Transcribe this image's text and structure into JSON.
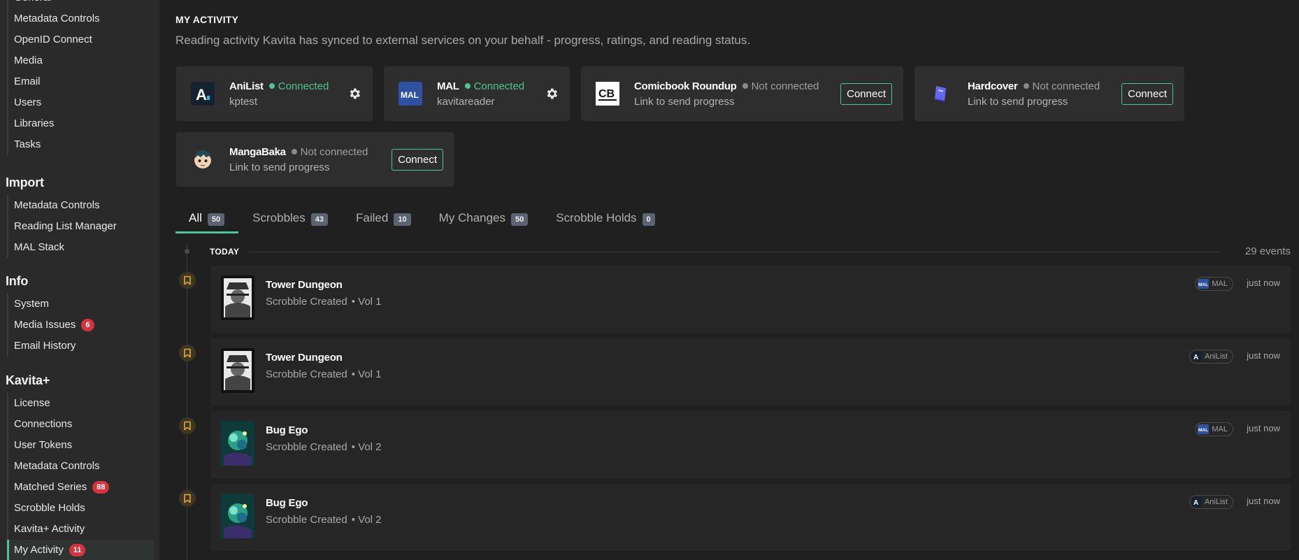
{
  "sidebar": {
    "top_partial_label": "General",
    "top_items": [
      {
        "label": "Metadata Controls"
      },
      {
        "label": "OpenID Connect"
      },
      {
        "label": "Media"
      },
      {
        "label": "Email"
      },
      {
        "label": "Users"
      },
      {
        "label": "Libraries"
      },
      {
        "label": "Tasks"
      }
    ],
    "import_header": "Import",
    "import_items": [
      {
        "label": "Metadata Controls"
      },
      {
        "label": "Reading List Manager"
      },
      {
        "label": "MAL Stack"
      }
    ],
    "info_header": "Info",
    "info_items": [
      {
        "label": "System"
      },
      {
        "label": "Media Issues",
        "badge": "6"
      },
      {
        "label": "Email History"
      }
    ],
    "kavita_header": "Kavita+",
    "kavita_items": [
      {
        "label": "License"
      },
      {
        "label": "Connections"
      },
      {
        "label": "User Tokens"
      },
      {
        "label": "Metadata Controls"
      },
      {
        "label": "Matched Series",
        "badge": "88"
      },
      {
        "label": "Scrobble Holds"
      },
      {
        "label": "Kavita+ Activity"
      },
      {
        "label": "My Activity",
        "badge": "11",
        "active": true
      }
    ]
  },
  "page": {
    "title": "MY ACTIVITY",
    "subtitle": "Reading activity Kavita has synced to external services on your behalf - progress, ratings, and reading status."
  },
  "services": [
    {
      "name": "AniList",
      "status": "Connected",
      "connected": true,
      "detail": "kptest",
      "icon": "anilist-logo-icon"
    },
    {
      "name": "MAL",
      "status": "Connected",
      "connected": true,
      "detail": "kavitareader",
      "icon": "mal-logo-icon"
    },
    {
      "name": "Comicbook Roundup",
      "status": "Not connected",
      "connected": false,
      "detail": "Link to send progress",
      "action": "Connect",
      "icon": "cbr-logo-icon"
    },
    {
      "name": "Hardcover",
      "status": "Not connected",
      "connected": false,
      "detail": "Link to send progress",
      "action": "Connect",
      "icon": "hardcover-logo-icon"
    },
    {
      "name": "MangaBaka",
      "status": "Not connected",
      "connected": false,
      "detail": "Link to send progress",
      "action": "Connect",
      "icon": "mangabaka-logo-icon"
    }
  ],
  "tabs": [
    {
      "label": "All",
      "count": "50",
      "active": true
    },
    {
      "label": "Scrobbles",
      "count": "43"
    },
    {
      "label": "Failed",
      "count": "10"
    },
    {
      "label": "My Changes",
      "count": "50"
    },
    {
      "label": "Scrobble Holds",
      "count": "0"
    }
  ],
  "timeline": {
    "group_label": "TODAY",
    "group_count": "29 events",
    "events": [
      {
        "title": "Tower Dungeon",
        "type": "Scrobble Created",
        "volume": "Vol 1",
        "provider": "MAL",
        "time": "just now",
        "icon": "bookmark-icon"
      },
      {
        "title": "Tower Dungeon",
        "type": "Scrobble Created",
        "volume": "Vol 1",
        "provider": "AniList",
        "time": "just now",
        "icon": "bookmark-icon"
      },
      {
        "title": "Bug Ego",
        "type": "Scrobble Created",
        "volume": "Vol 2",
        "provider": "MAL",
        "time": "just now",
        "icon": "bookmark-icon"
      },
      {
        "title": "Bug Ego",
        "type": "Scrobble Created",
        "volume": "Vol 2",
        "provider": "AniList",
        "time": "just now",
        "icon": "bookmark-icon"
      }
    ]
  },
  "colors": {
    "accent": "#4ac694",
    "badge_red": "#d6333f",
    "bookmark_gold": "#e5a72e",
    "background": "#202020",
    "card": "#2e2e2e"
  }
}
